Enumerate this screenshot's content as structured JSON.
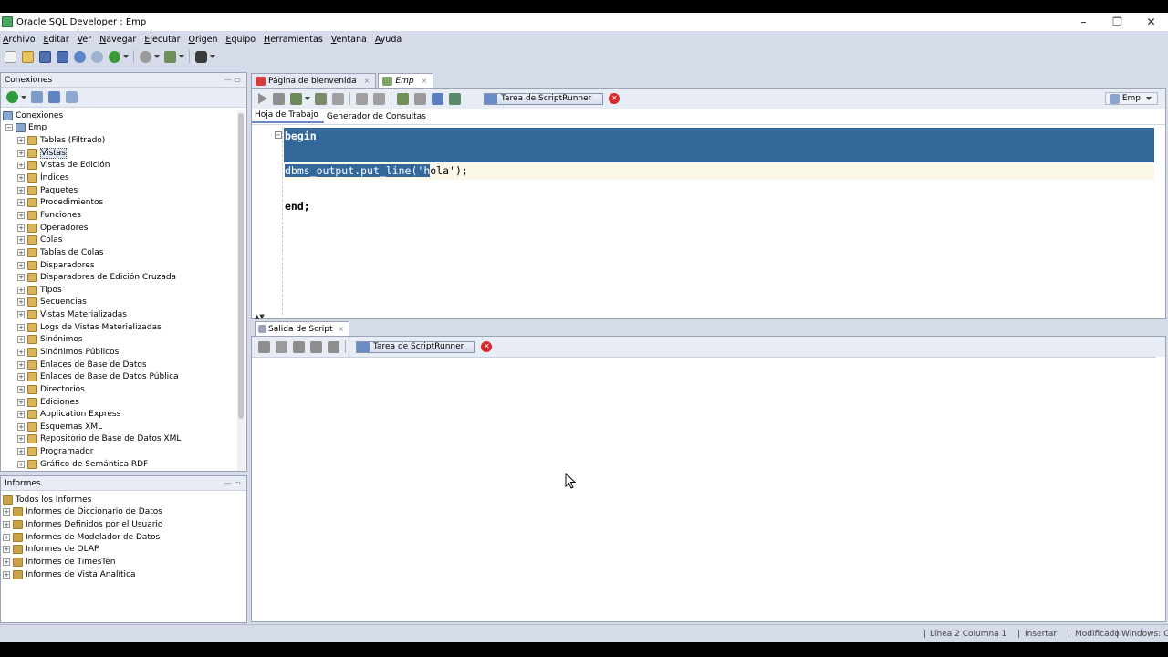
{
  "window": {
    "title": "Oracle SQL Developer : Emp",
    "minimize": "–",
    "maximize": "❐",
    "close": "✕"
  },
  "menu": [
    "Archivo",
    "Editar",
    "Ver",
    "Navegar",
    "Ejecutar",
    "Origen",
    "Equipo",
    "Herramientas",
    "Ventana",
    "Ayuda"
  ],
  "connections_panel": {
    "title": "Conexiones",
    "root": "Conexiones",
    "connection": "Emp",
    "items": [
      "Tablas (Filtrado)",
      "Vistas",
      "Vistas de Edición",
      "Índices",
      "Paquetes",
      "Procedimientos",
      "Funciones",
      "Operadores",
      "Colas",
      "Tablas de Colas",
      "Disparadores",
      "Disparadores de Edición Cruzada",
      "Tipos",
      "Secuencias",
      "Vistas Materializadas",
      "Logs de Vistas Materializadas",
      "Sinónimos",
      "Sinónimos Públicos",
      "Enlaces de Base de Datos",
      "Enlaces de Base de Datos Pública",
      "Directorios",
      "Ediciones",
      "Application Express",
      "Esquemas XML",
      "Repositorio de Base de Datos XML",
      "Programador",
      "Gráfico de Semántica RDF"
    ],
    "selected_item": "Vistas"
  },
  "reports_panel": {
    "title": "Informes",
    "root": "Todos los Informes",
    "items": [
      "Informes de Diccionario de Datos",
      "Informes Definidos por el Usuario",
      "Informes de Modelador de Datos",
      "Informes de OLAP",
      "Informes de TimesTen",
      "Informes de Vista Analítica"
    ]
  },
  "editor": {
    "tabs": [
      {
        "label": "Página de bienvenida",
        "active": false
      },
      {
        "label": "Emp",
        "active": true
      }
    ],
    "task_label": "Tarea de ScriptRunner",
    "connection_selector": "Emp",
    "subtabs": [
      "Hoja de Trabajo",
      "Generador de Consultas"
    ],
    "active_subtab": "Hoja de Trabajo",
    "code": {
      "line1": "begin",
      "line2_selected": "dbms_output.put_line('h",
      "line2_rest": "ola');",
      "line3": "end;"
    }
  },
  "output": {
    "tab_label": "Salida de Script",
    "task_label": "Tarea de ScriptRunner"
  },
  "statusbar": {
    "position": "Línea 2 Columna 1",
    "mode": "Insertar",
    "modified": "Modificado",
    "os": "Windows: C|"
  },
  "colors": {
    "chrome": "#d6dbe9",
    "selection": "#34679a",
    "current_line": "#fbf8e8",
    "cancel": "#d62b2b"
  }
}
